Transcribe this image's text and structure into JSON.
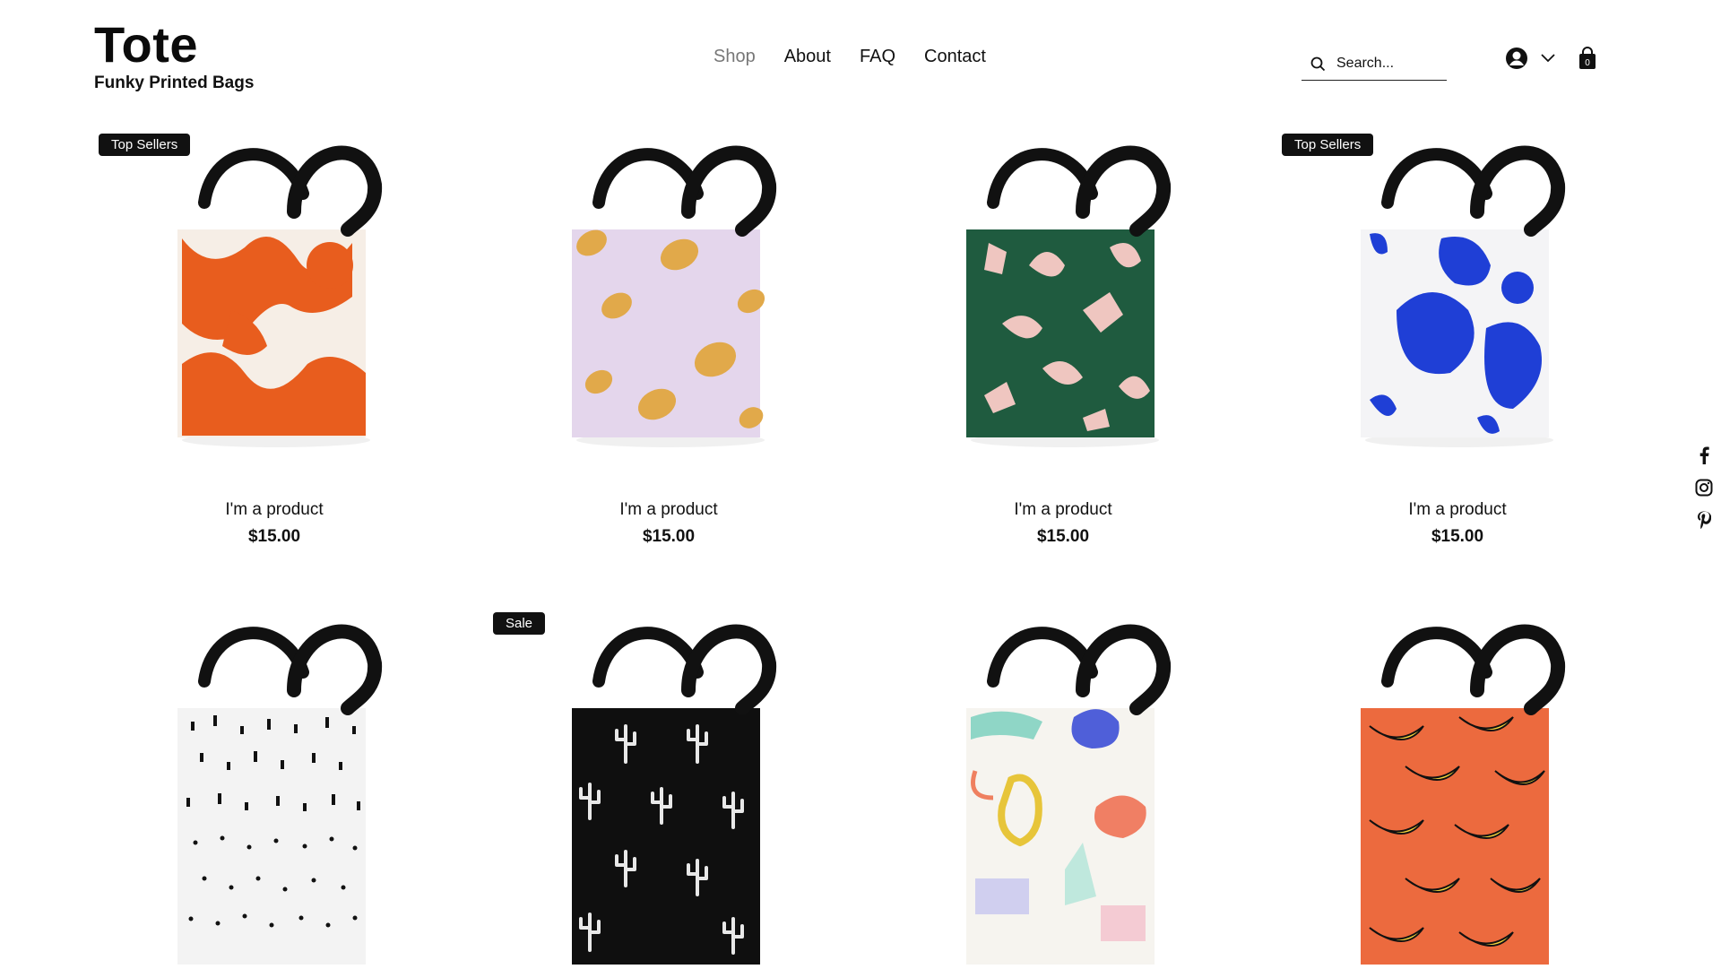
{
  "brand": {
    "title": "Tote",
    "subtitle": "Funky Printed Bags"
  },
  "nav": {
    "items": [
      {
        "label": "Shop",
        "active": true
      },
      {
        "label": "About",
        "active": false
      },
      {
        "label": "FAQ",
        "active": false
      },
      {
        "label": "Contact",
        "active": false
      }
    ]
  },
  "search": {
    "placeholder": "Search..."
  },
  "cart": {
    "count": "0"
  },
  "colors": {
    "accent": "#111111",
    "muted": "#777777"
  },
  "products": [
    {
      "name": "I'm a product",
      "price": "$15.00",
      "badge": "Top Sellers",
      "pattern": "orange-strokes"
    },
    {
      "name": "I'm a product",
      "price": "$15.00",
      "badge": "",
      "pattern": "lilac-lemons"
    },
    {
      "name": "I'm a product",
      "price": "$15.00",
      "badge": "",
      "pattern": "green-hands"
    },
    {
      "name": "I'm a product",
      "price": "$15.00",
      "badge": "Top Sellers",
      "pattern": "blue-blobs"
    },
    {
      "name": "",
      "price": "",
      "badge": "",
      "pattern": "white-dots"
    },
    {
      "name": "",
      "price": "",
      "badge": "Sale",
      "pattern": "black-cactus"
    },
    {
      "name": "",
      "price": "",
      "badge": "",
      "pattern": "pastel-abstract"
    },
    {
      "name": "",
      "price": "",
      "badge": "",
      "pattern": "orange-bananas"
    }
  ],
  "social": [
    "facebook-icon",
    "instagram-icon",
    "pinterest-icon"
  ]
}
